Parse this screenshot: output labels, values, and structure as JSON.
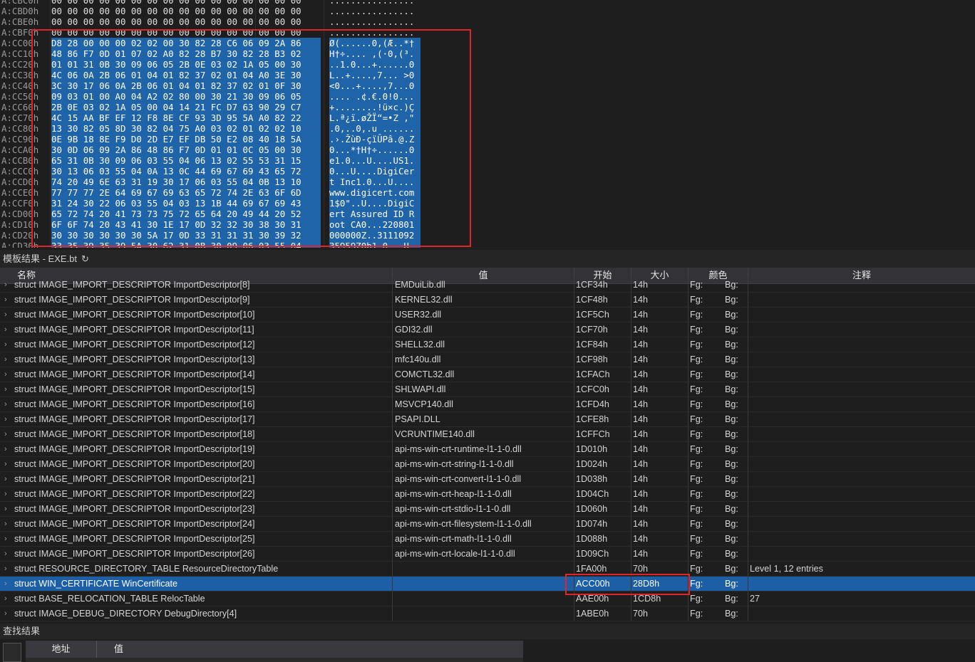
{
  "hex_view": {
    "rows": [
      {
        "addr": "A:CBC0h",
        "bytes": "00 00 00 00 00 00 00 00 00 00 00 00 00 00 00 00",
        "ascii": "................",
        "sel": false
      },
      {
        "addr": "A:CBD0h",
        "bytes": "00 00 00 00 00 00 00 00 00 00 00 00 00 00 00 00",
        "ascii": "................",
        "sel": false
      },
      {
        "addr": "A:CBE0h",
        "bytes": "00 00 00 00 00 00 00 00 00 00 00 00 00 00 00 00",
        "ascii": "................",
        "sel": false
      },
      {
        "addr": "A:CBF0h",
        "bytes": "00 00 00 00 00 00 00 00 00 00 00 00 00 00 00 00",
        "ascii": "................",
        "sel": false
      },
      {
        "addr": "A:CC00h",
        "bytes": "D8 28 00 00 00 02 02 00 30 82 28 C6 06 09 2A 86",
        "ascii": "Ø(......0‚(Æ..*†",
        "sel": true
      },
      {
        "addr": "A:CC10h",
        "bytes": "48 86 F7 0D 01 07 02 A0 82 28 B7 30 82 28 B3 02",
        "ascii": "H†÷.... ‚(·0‚(³.",
        "sel": true
      },
      {
        "addr": "A:CC20h",
        "bytes": "01 01 31 0B 30 09 06 05 2B 0E 03 02 1A 05 00 30",
        "ascii": "..1.0...+......0",
        "sel": true
      },
      {
        "addr": "A:CC30h",
        "bytes": "4C 06 0A 2B 06 01 04 01 82 37 02 01 04 A0 3E 30",
        "ascii": "L..+....‚7... >0",
        "sel": true
      },
      {
        "addr": "A:CC40h",
        "bytes": "3C 30 17 06 0A 2B 06 01 04 01 82 37 02 01 0F 30",
        "ascii": "<0...+....‚7...0",
        "sel": true
      },
      {
        "addr": "A:CC50h",
        "bytes": "09 03 01 00 A0 04 A2 02 80 00 30 21 30 09 06 05",
        "ascii": ".... .¢.€.0!0...",
        "sel": true
      },
      {
        "addr": "A:CC60h",
        "bytes": "2B 0E 03 02 1A 05 00 04 14 21 FC D7 63 90 29 C7",
        "ascii": "+........!ü×c.)Ç",
        "sel": true
      },
      {
        "addr": "A:CC70h",
        "bytes": "4C 15 AA BF EF 12 F8 8E CF 93 3D 95 5A A0 82 22",
        "ascii": "L.ª¿ï.øŽÏ“=•Z ‚\"",
        "sel": true
      },
      {
        "addr": "A:CC80h",
        "bytes": "13 30 82 05 8D 30 82 04 75 A0 03 02 01 02 02 10",
        "ascii": ".0‚..0‚.u ......",
        "sel": true
      },
      {
        "addr": "A:CC90h",
        "bytes": "0E 9B 18 8E F9 D0 2D E7 EF DB 50 E2 08 40 18 5A",
        "ascii": ".›.ŽùÐ-çïÛPâ.@.Z",
        "sel": true
      },
      {
        "addr": "A:CCA0h",
        "bytes": "30 0D 06 09 2A 86 48 86 F7 0D 01 01 0C 05 00 30",
        "ascii": "0...*†H†÷......0",
        "sel": true
      },
      {
        "addr": "A:CCB0h",
        "bytes": "65 31 0B 30 09 06 03 55 04 06 13 02 55 53 31 15",
        "ascii": "e1.0...U....US1.",
        "sel": true
      },
      {
        "addr": "A:CCC0h",
        "bytes": "30 13 06 03 55 04 0A 13 0C 44 69 67 69 43 65 72",
        "ascii": "0...U....DigiCer",
        "sel": true
      },
      {
        "addr": "A:CCD0h",
        "bytes": "74 20 49 6E 63 31 19 30 17 06 03 55 04 0B 13 10",
        "ascii": "t Inc1.0...U....",
        "sel": true
      },
      {
        "addr": "A:CCE0h",
        "bytes": "77 77 77 2E 64 69 67 69 63 65 72 74 2E 63 6F 6D",
        "ascii": "www.digicert.com",
        "sel": true
      },
      {
        "addr": "A:CCF0h",
        "bytes": "31 24 30 22 06 03 55 04 03 13 1B 44 69 67 69 43",
        "ascii": "1$0\"..U....DigiC",
        "sel": true
      },
      {
        "addr": "A:CD00h",
        "bytes": "65 72 74 20 41 73 73 75 72 65 64 20 49 44 20 52",
        "ascii": "ert Assured ID R",
        "sel": true
      },
      {
        "addr": "A:CD10h",
        "bytes": "6F 6F 74 20 43 41 30 1E 17 0D 32 32 30 38 30 31",
        "ascii": "oot CA0...220801",
        "sel": true
      },
      {
        "addr": "A:CD20h",
        "bytes": "30 30 30 30 30 30 5A 17 0D 33 31 31 31 30 39 32",
        "ascii": "000000Z..3111092",
        "sel": true
      },
      {
        "addr": "A:CD30h",
        "bytes": "33 35 39 35 39 5A 30 62 31 0B 30 09 06 03 55 04",
        "ascii": "35959Z0b1.0...U.",
        "sel": true
      }
    ]
  },
  "template_results": {
    "title": "模板结果 - EXE.bt",
    "refresh_glyph": "↻",
    "columns": {
      "name": "名称",
      "value": "值",
      "start": "开始",
      "size": "大小",
      "color": "颜色",
      "comment": "注释"
    },
    "rows": [
      {
        "name": "struct IMAGE_IMPORT_DESCRIPTOR ImportDescriptor[8]",
        "value": "EMDuiLib.dll",
        "start": "1CF34h",
        "size": "14h",
        "fg": "Fg:",
        "bg": "Bg:",
        "comment": ""
      },
      {
        "name": "struct IMAGE_IMPORT_DESCRIPTOR ImportDescriptor[9]",
        "value": "KERNEL32.dll",
        "start": "1CF48h",
        "size": "14h",
        "fg": "Fg:",
        "bg": "Bg:",
        "comment": ""
      },
      {
        "name": "struct IMAGE_IMPORT_DESCRIPTOR ImportDescriptor[10]",
        "value": "USER32.dll",
        "start": "1CF5Ch",
        "size": "14h",
        "fg": "Fg:",
        "bg": "Bg:",
        "comment": ""
      },
      {
        "name": "struct IMAGE_IMPORT_DESCRIPTOR ImportDescriptor[11]",
        "value": "GDI32.dll",
        "start": "1CF70h",
        "size": "14h",
        "fg": "Fg:",
        "bg": "Bg:",
        "comment": ""
      },
      {
        "name": "struct IMAGE_IMPORT_DESCRIPTOR ImportDescriptor[12]",
        "value": "SHELL32.dll",
        "start": "1CF84h",
        "size": "14h",
        "fg": "Fg:",
        "bg": "Bg:",
        "comment": ""
      },
      {
        "name": "struct IMAGE_IMPORT_DESCRIPTOR ImportDescriptor[13]",
        "value": "mfc140u.dll",
        "start": "1CF98h",
        "size": "14h",
        "fg": "Fg:",
        "bg": "Bg:",
        "comment": ""
      },
      {
        "name": "struct IMAGE_IMPORT_DESCRIPTOR ImportDescriptor[14]",
        "value": "COMCTL32.dll",
        "start": "1CFACh",
        "size": "14h",
        "fg": "Fg:",
        "bg": "Bg:",
        "comment": ""
      },
      {
        "name": "struct IMAGE_IMPORT_DESCRIPTOR ImportDescriptor[15]",
        "value": "SHLWAPI.dll",
        "start": "1CFC0h",
        "size": "14h",
        "fg": "Fg:",
        "bg": "Bg:",
        "comment": ""
      },
      {
        "name": "struct IMAGE_IMPORT_DESCRIPTOR ImportDescriptor[16]",
        "value": "MSVCP140.dll",
        "start": "1CFD4h",
        "size": "14h",
        "fg": "Fg:",
        "bg": "Bg:",
        "comment": ""
      },
      {
        "name": "struct IMAGE_IMPORT_DESCRIPTOR ImportDescriptor[17]",
        "value": "PSAPI.DLL",
        "start": "1CFE8h",
        "size": "14h",
        "fg": "Fg:",
        "bg": "Bg:",
        "comment": ""
      },
      {
        "name": "struct IMAGE_IMPORT_DESCRIPTOR ImportDescriptor[18]",
        "value": "VCRUNTIME140.dll",
        "start": "1CFFCh",
        "size": "14h",
        "fg": "Fg:",
        "bg": "Bg:",
        "comment": ""
      },
      {
        "name": "struct IMAGE_IMPORT_DESCRIPTOR ImportDescriptor[19]",
        "value": "api-ms-win-crt-runtime-l1-1-0.dll",
        "start": "1D010h",
        "size": "14h",
        "fg": "Fg:",
        "bg": "Bg:",
        "comment": ""
      },
      {
        "name": "struct IMAGE_IMPORT_DESCRIPTOR ImportDescriptor[20]",
        "value": "api-ms-win-crt-string-l1-1-0.dll",
        "start": "1D024h",
        "size": "14h",
        "fg": "Fg:",
        "bg": "Bg:",
        "comment": ""
      },
      {
        "name": "struct IMAGE_IMPORT_DESCRIPTOR ImportDescriptor[21]",
        "value": "api-ms-win-crt-convert-l1-1-0.dll",
        "start": "1D038h",
        "size": "14h",
        "fg": "Fg:",
        "bg": "Bg:",
        "comment": ""
      },
      {
        "name": "struct IMAGE_IMPORT_DESCRIPTOR ImportDescriptor[22]",
        "value": "api-ms-win-crt-heap-l1-1-0.dll",
        "start": "1D04Ch",
        "size": "14h",
        "fg": "Fg:",
        "bg": "Bg:",
        "comment": ""
      },
      {
        "name": "struct IMAGE_IMPORT_DESCRIPTOR ImportDescriptor[23]",
        "value": "api-ms-win-crt-stdio-l1-1-0.dll",
        "start": "1D060h",
        "size": "14h",
        "fg": "Fg:",
        "bg": "Bg:",
        "comment": ""
      },
      {
        "name": "struct IMAGE_IMPORT_DESCRIPTOR ImportDescriptor[24]",
        "value": "api-ms-win-crt-filesystem-l1-1-0.dll",
        "start": "1D074h",
        "size": "14h",
        "fg": "Fg:",
        "bg": "Bg:",
        "comment": ""
      },
      {
        "name": "struct IMAGE_IMPORT_DESCRIPTOR ImportDescriptor[25]",
        "value": "api-ms-win-crt-math-l1-1-0.dll",
        "start": "1D088h",
        "size": "14h",
        "fg": "Fg:",
        "bg": "Bg:",
        "comment": ""
      },
      {
        "name": "struct IMAGE_IMPORT_DESCRIPTOR ImportDescriptor[26]",
        "value": "api-ms-win-crt-locale-l1-1-0.dll",
        "start": "1D09Ch",
        "size": "14h",
        "fg": "Fg:",
        "bg": "Bg:",
        "comment": ""
      },
      {
        "name": "struct RESOURCE_DIRECTORY_TABLE ResourceDirectoryTable",
        "value": "",
        "start": "1FA00h",
        "size": "70h",
        "fg": "Fg:",
        "bg": "Bg:",
        "comment": "Level 1, 12 entries"
      },
      {
        "name": "struct WIN_CERTIFICATE WinCertificate",
        "value": "",
        "start": "ACC00h",
        "size": "28D8h",
        "fg": "Fg:",
        "bg": "Bg:",
        "comment": "",
        "selected": true
      },
      {
        "name": "struct BASE_RELOCATION_TABLE RelocTable",
        "value": "",
        "start": "AAE00h",
        "size": "1CD8h",
        "fg": "Fg:",
        "bg": "Bg:",
        "comment": "27"
      },
      {
        "name": "struct IMAGE_DEBUG_DIRECTORY DebugDirectory[4]",
        "value": "",
        "start": "1ABE0h",
        "size": "70h",
        "fg": "Fg:",
        "bg": "Bg:",
        "comment": ""
      }
    ]
  },
  "find_results": {
    "title": "查找结果",
    "columns": {
      "address": "地址",
      "value": "值"
    }
  },
  "colors": {
    "selection": "#1c5fa6",
    "highlight_box": "#e0242a",
    "background": "#1e1e1e"
  }
}
